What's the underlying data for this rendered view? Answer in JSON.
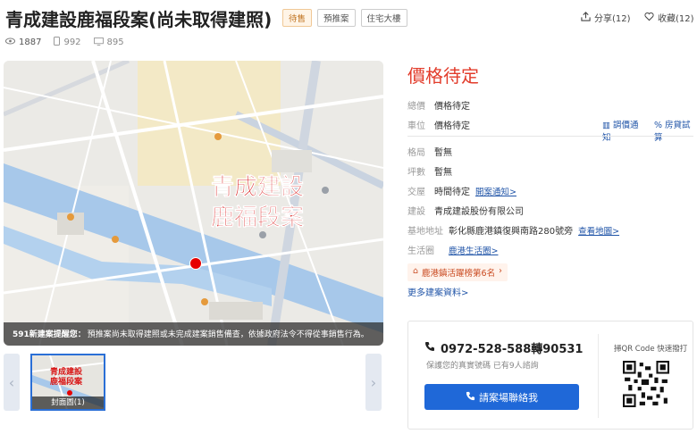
{
  "header": {
    "title": "青成建設鹿福段案(尚未取得建照)",
    "tags": [
      "待售",
      "預推案",
      "住宅大樓"
    ],
    "share_label": "分享(12)",
    "fav_label": "收藏(12)"
  },
  "stats": {
    "views": "1887",
    "mobile_views": "992",
    "pc_views": "895"
  },
  "map": {
    "overlay_title_line1": "青成建設",
    "overlay_title_line2": "鹿福段案",
    "caption_bold": "591新建案提醒您：",
    "caption_text": "預推案尚未取得建照或未完成建案銷售備查，依據政府法令不得從事銷售行為。"
  },
  "thumbnails": [
    {
      "line1": "青成建設",
      "line2": "鹿福段案",
      "caption": "封面圖(1)"
    }
  ],
  "details": {
    "price_status": "價格待定",
    "rows": [
      {
        "label": "總價",
        "value": "價格待定"
      },
      {
        "label": "車位",
        "value": "價格待定"
      },
      {
        "label": "格局",
        "value": "暫無"
      },
      {
        "label": "坪數",
        "value": "暫無"
      },
      {
        "label": "交屋",
        "value": "時間待定",
        "link": "開案通知>"
      },
      {
        "label": "建設",
        "value": "青成建設股份有限公司"
      },
      {
        "label": "基地地址",
        "value": "彰化縣鹿港鎮復興南路280號旁",
        "link": "查看地圖>"
      },
      {
        "label": "生活圈",
        "value": "",
        "link": "鹿港生活圈>"
      }
    ],
    "price_alert": "調價通知",
    "loan_calc": "房貸試算",
    "ranking": "鹿港鎮活躍榜第6名",
    "more": "更多建案資料>"
  },
  "contact": {
    "phone": "0972-528-588轉90531",
    "note": "保護您的真實號碼 已有9人諮詢",
    "call_label": "請案場聯絡我",
    "qr_label": "掃QR Code 快速撥打"
  },
  "colors": {
    "accent": "#e23b2a",
    "link": "#2155a8",
    "button": "#1f68d8"
  }
}
